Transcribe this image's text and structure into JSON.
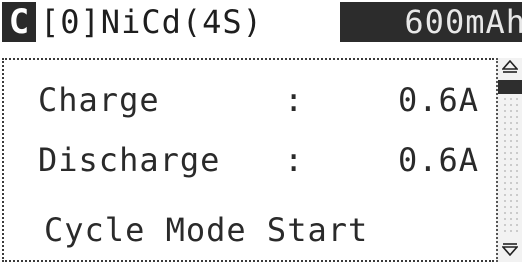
{
  "status_bar": {
    "mode_badge": "C",
    "slot_label": "[0]NiCd(4S)",
    "capacity": "600mAh"
  },
  "settings": [
    {
      "label": "Charge",
      "separator": ":",
      "value": "0.6A"
    },
    {
      "label": "Discharge",
      "separator": ":",
      "value": "0.6A"
    }
  ],
  "action": {
    "label": "Cycle Mode Start"
  },
  "scrollbar": {
    "up_icon": "triangle-up-icon",
    "down_icon": "triangle-down-icon"
  }
}
